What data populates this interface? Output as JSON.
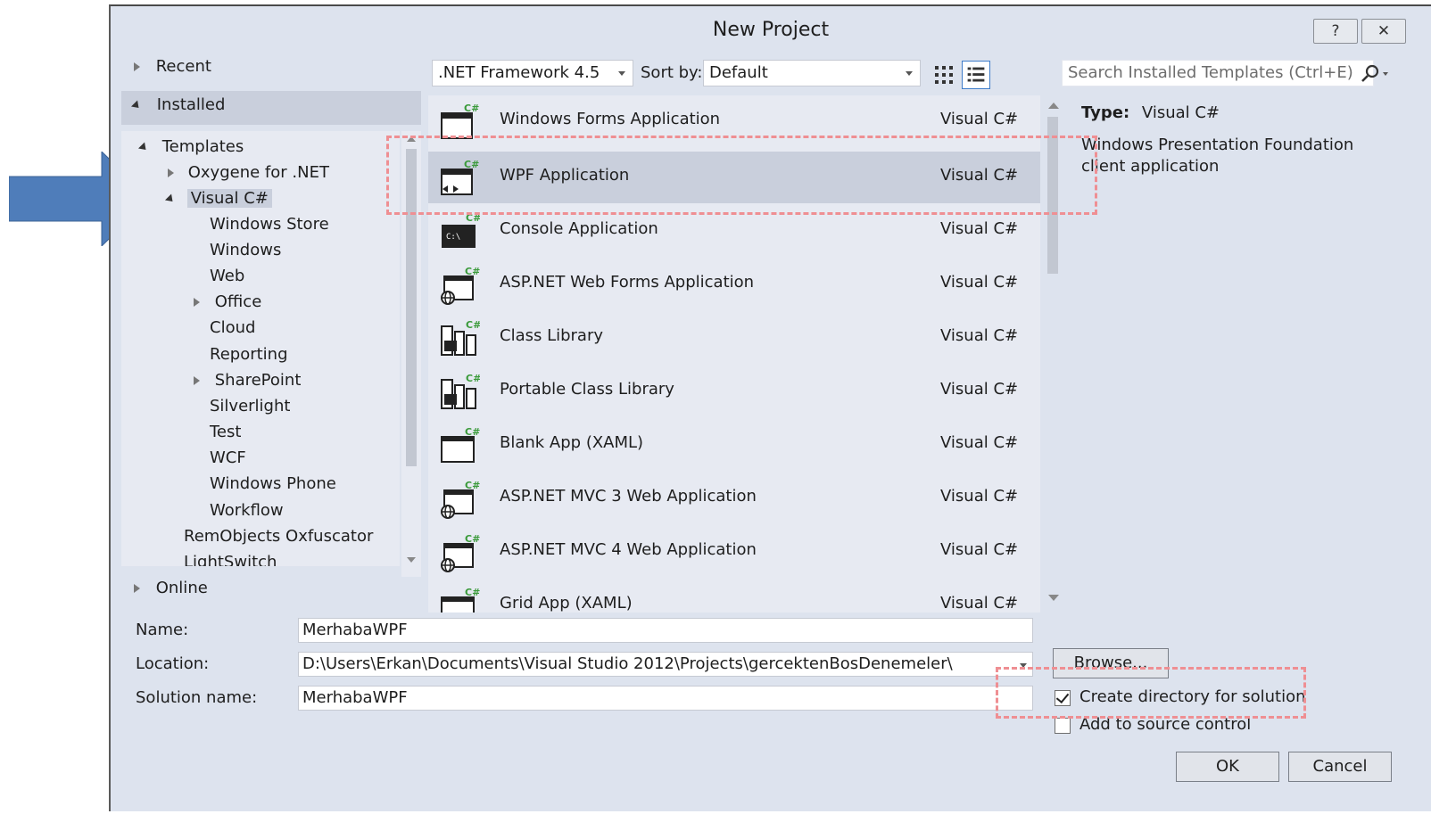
{
  "window": {
    "title": "New Project",
    "help_glyph": "?",
    "close_glyph": "✕"
  },
  "colors": {
    "accent_arrow": "#4f7dba",
    "highlight_dash": "#ef8f93",
    "selection": "#c9cfdc"
  },
  "tree": {
    "recent": "Recent",
    "installed": "Installed",
    "templates": "Templates",
    "oxygene": "Oxygene for .NET",
    "visual_csharp": "Visual C#",
    "children": [
      "Windows Store",
      "Windows",
      "Web",
      "Office",
      "Cloud",
      "Reporting",
      "SharePoint",
      "Silverlight",
      "Test",
      "WCF",
      "Windows Phone",
      "Workflow"
    ],
    "remobjects": "RemObjects Oxfuscator",
    "lightswitch": "LightSwitch",
    "online": "Online"
  },
  "toolbar": {
    "framework": ".NET Framework 4.5",
    "sort_label": "Sort by:",
    "sort_value": "Default",
    "search_placeholder": "Search Installed Templates (Ctrl+E)"
  },
  "templates": [
    {
      "name": "Windows Forms Application",
      "lang": "Visual C#",
      "icon": "windows-forms-icon"
    },
    {
      "name": "WPF Application",
      "lang": "Visual C#",
      "icon": "wpf-icon"
    },
    {
      "name": "Console Application",
      "lang": "Visual C#",
      "icon": "console-icon"
    },
    {
      "name": "ASP.NET Web Forms Application",
      "lang": "Visual C#",
      "icon": "web-icon"
    },
    {
      "name": "Class Library",
      "lang": "Visual C#",
      "icon": "class-library-icon"
    },
    {
      "name": "Portable Class Library",
      "lang": "Visual C#",
      "icon": "class-library-icon"
    },
    {
      "name": "Blank App (XAML)",
      "lang": "Visual C#",
      "icon": "blank-app-icon"
    },
    {
      "name": "ASP.NET MVC 3 Web Application",
      "lang": "Visual C#",
      "icon": "web-icon"
    },
    {
      "name": "ASP.NET MVC 4 Web Application",
      "lang": "Visual C#",
      "icon": "web-icon"
    },
    {
      "name": "Grid App (XAML)",
      "lang": "Visual C#",
      "icon": "grid-app-icon"
    }
  ],
  "description": {
    "type_label": "Type:",
    "type_value": "Visual C#",
    "text": "Windows Presentation Foundation client application"
  },
  "form": {
    "name_label": "Name:",
    "name_value": "MerhabaWPF",
    "location_label": "Location:",
    "location_value": "D:\\Users\\Erkan\\Documents\\Visual Studio 2012\\Projects\\gercektenBosDenemeler\\",
    "solution_label": "Solution name:",
    "solution_value": "MerhabaWPF",
    "browse": "Browse...",
    "create_dir": "Create directory for solution",
    "add_source": "Add to source control",
    "ok": "OK",
    "cancel": "Cancel"
  }
}
